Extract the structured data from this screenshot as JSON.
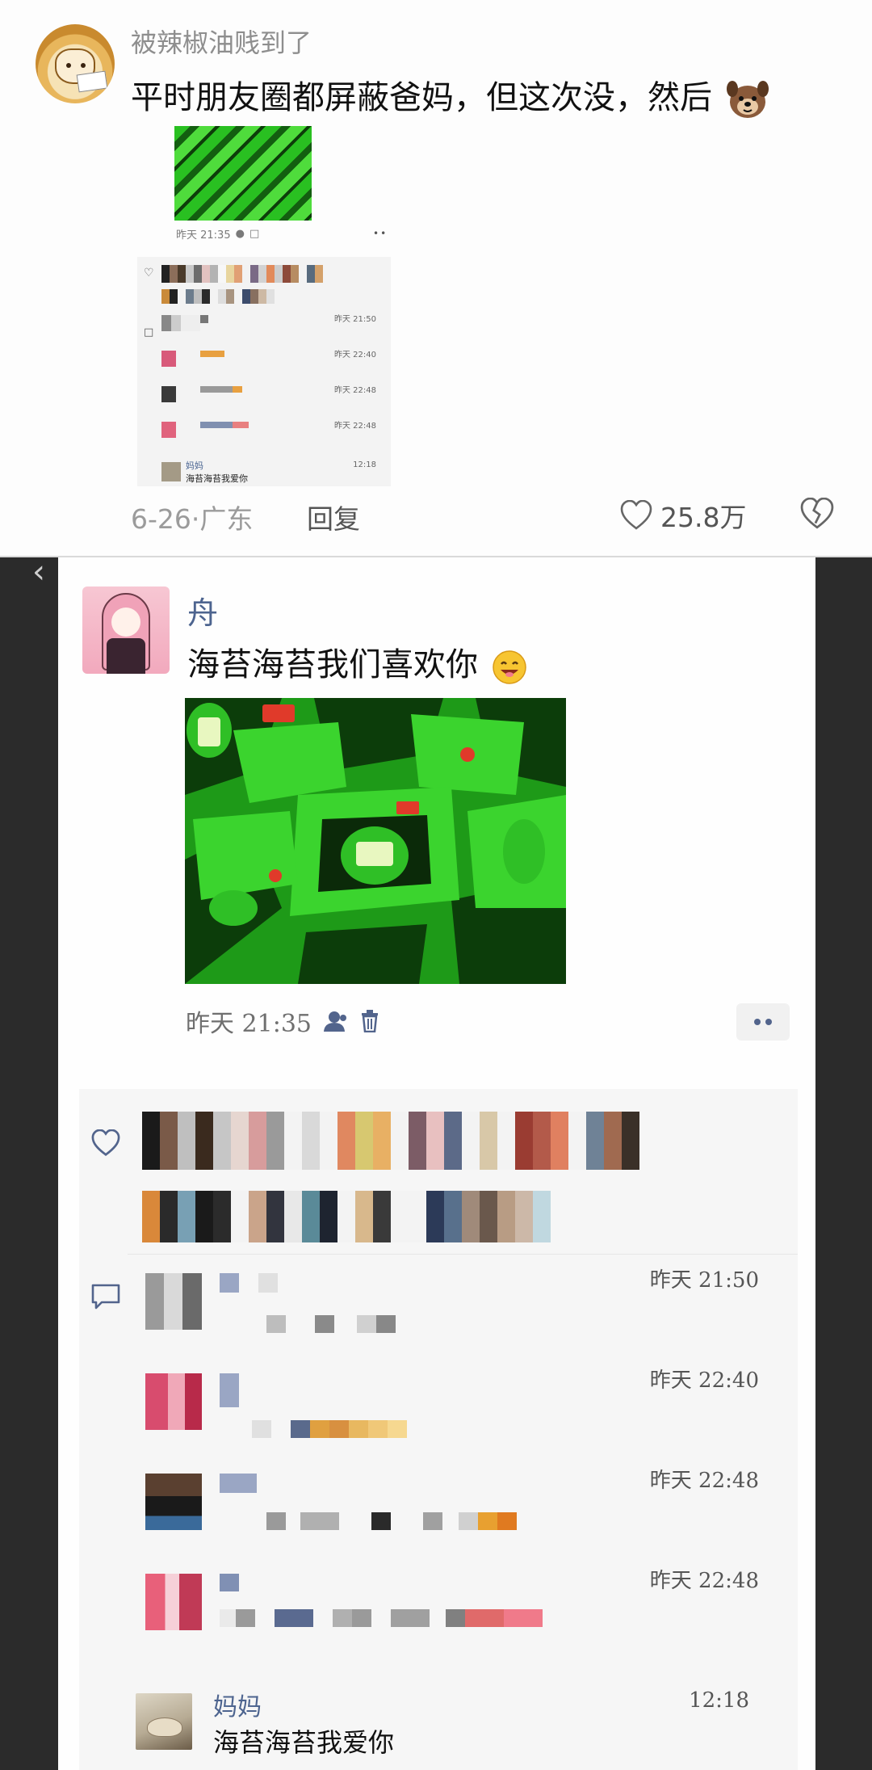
{
  "comment": {
    "username": "被辣椒油贱到了",
    "text": "平时朋友圈都屏蔽爸妈，但这次没，然后",
    "emoji": "dog-face-icon",
    "date_location": "6-26·广东",
    "reply_label": "回复",
    "like_count": "25.8万",
    "mini_screenshot": {
      "meta": "昨天 21:35",
      "timestamps": [
        "昨天 21:50",
        "昨天 22:40",
        "昨天 22:48",
        "昨天 22:48"
      ],
      "mom_name": "妈妈",
      "mom_text": "海苔海苔我爱你",
      "mom_time": "12:18"
    }
  },
  "post": {
    "author": "舟",
    "text": "海苔海苔我们喜欢你",
    "emoji": "smiling-face-icon",
    "time": "昨天 21:35",
    "comments": [
      {
        "time": "昨天 21:50"
      },
      {
        "time": "昨天 22:40"
      },
      {
        "time": "昨天 22:48"
      },
      {
        "time": "昨天 22:48"
      }
    ],
    "mom_comment": {
      "name": "妈妈",
      "text": "海苔海苔我爱你",
      "time": "12:18"
    }
  },
  "colors": {
    "nickname": "#4d648f",
    "seaweed_green": "#2ec224"
  }
}
